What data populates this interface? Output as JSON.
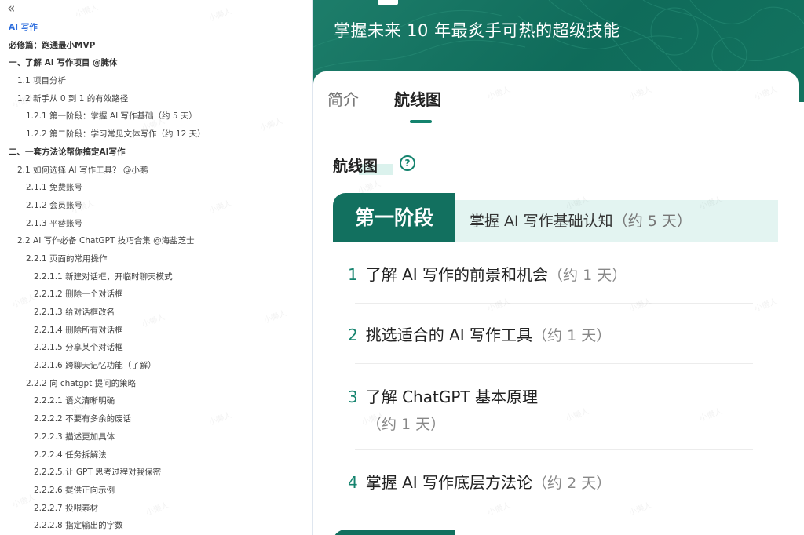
{
  "outline": {
    "collapse_glyph": "«",
    "items": [
      {
        "label": "AI 写作"
      },
      {
        "label": "必修篇：跑通最小MVP"
      },
      {
        "label": "一、了解 AI 写作项目 @腌体"
      },
      {
        "label": "1.1 项目分析"
      },
      {
        "label": "1.2 新手从 0 到 1 的有效路径"
      },
      {
        "label": "1.2.1 第一阶段：掌握 AI 写作基础（约 5 天）"
      },
      {
        "label": "1.2.2 第二阶段：学习常见文体写作（约 12 天）"
      },
      {
        "label": "二、一套方法论帮你搞定AI写作"
      },
      {
        "label": "2.1 如何选择 AI 写作工具？ @小鹅"
      },
      {
        "label": "2.1.1 免费账号"
      },
      {
        "label": "2.1.2 会员账号"
      },
      {
        "label": "2.1.3 平替账号"
      },
      {
        "label": "2.2 AI 写作必备 ChatGPT 技巧合集 @海盐芝士"
      },
      {
        "label": "2.2.1 页面的常用操作"
      },
      {
        "label": "2.2.1.1 新建对话框，开临时聊天模式"
      },
      {
        "label": "2.2.1.2 删除一个对话框"
      },
      {
        "label": "2.2.1.3 给对话框改名"
      },
      {
        "label": "2.2.1.4 删除所有对话框"
      },
      {
        "label": "2.2.1.5 分享某个对话框"
      },
      {
        "label": "2.2.1.6 跨聊天记忆功能（了解）"
      },
      {
        "label": "2.2.2 向 chatgpt 提问的策略"
      },
      {
        "label": "2.2.2.1 语义清晰明确"
      },
      {
        "label": "2.2.2.2 不要有多余的废话"
      },
      {
        "label": "2.2.2.3 描述更加具体"
      },
      {
        "label": "2.2.2.4 任务拆解法"
      },
      {
        "label": "2.2.2.5.让 GPT 思考过程对我保密"
      },
      {
        "label": "2.2.2.6 提供正向示例"
      },
      {
        "label": "2.2.2.7 投喂素材"
      },
      {
        "label": "2.2.2.8 指定输出的字数"
      }
    ]
  },
  "hero": {
    "subtitle": "掌握未来 10 年最炙手可热的超级技能"
  },
  "tabs": {
    "intro": "简介",
    "roadmap": "航线图"
  },
  "section": {
    "title": "航线图",
    "help_glyph": "?"
  },
  "stage": {
    "tag": "第一阶段",
    "desc": "掌握 AI 写作基础认知",
    "duration": "（约 5 天）"
  },
  "steps": [
    {
      "num": "1",
      "title": "了解 AI 写作的前景和机会",
      "duration": "（约 1 天）"
    },
    {
      "num": "2",
      "title": "挑选适合的 AI 写作工具",
      "duration": "（约 1 天）"
    },
    {
      "num": "3",
      "title": "了解 ChatGPT 基本原理",
      "duration": "（约 1 天）"
    },
    {
      "num": "4",
      "title": "掌握 AI 写作底层方法论",
      "duration": "（约 2 天）"
    }
  ],
  "watermark": "小懒人",
  "colors": {
    "brand": "#12705f",
    "accent": "#14836e",
    "link_active": "#2f6fde"
  }
}
